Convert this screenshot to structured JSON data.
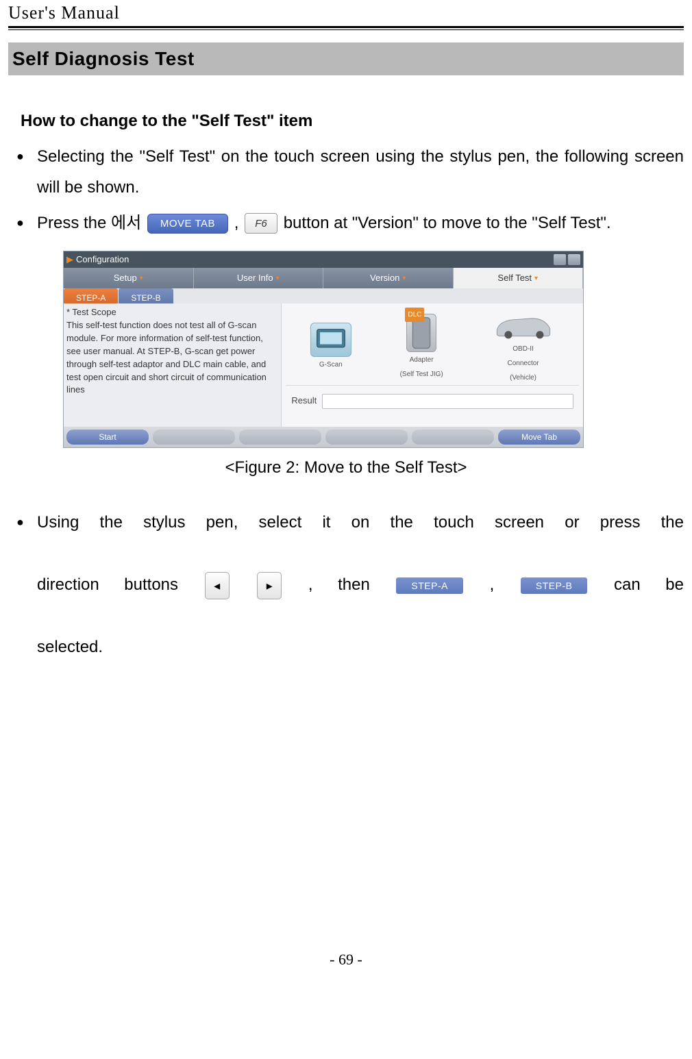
{
  "header": {
    "title": "User's Manual"
  },
  "section_banner": "Self Diagnosis Test",
  "subheading": "How to change to the \"Self Test\" item",
  "bullet1": {
    "text": "Selecting the \"Self Test\" on the touch screen using the stylus pen, the following screen will be shown."
  },
  "bullet2": {
    "pre": "Press the 에서 ",
    "chip_movetab": "MOVE TAB",
    "mid1": ", ",
    "chip_key": "F6",
    "post": " button at \"Version\" to move to the \"Self Test\"."
  },
  "figure": {
    "window": {
      "titlebar_arrow": "▶",
      "title": "Configuration",
      "tabs": {
        "setup": "Setup",
        "userinfo": "User Info",
        "version": "Version",
        "selftest": "Self Test"
      },
      "subtabs": {
        "a": "STEP-A",
        "b": "STEP-B"
      },
      "scope_title": "* Test Scope",
      "scope_body": "This self-test function does not test all of G-scan module. For more information of self-test function, see user manual. At STEP-B, G-scan get power through self-test adaptor and DLC main cable, and test open circuit and short circuit of communication lines",
      "dlc_label": "DLC",
      "dev_gscan": "G-Scan",
      "dev_adapter_l1": "Adapter",
      "dev_adapter_l2": "(Self Test JIG)",
      "dev_conn_l1": "OBD-II",
      "dev_conn_l2": "Connector",
      "dev_conn_l3": "(Vehicle)",
      "result_label": "Result",
      "footer": {
        "start": "Start",
        "movetab": "Move Tab"
      }
    },
    "caption": "<Figure 2: Move to the Self Test>"
  },
  "bullet3": {
    "line1_pre": "Using the stylus pen, select it on the touch screen or press the",
    "line2_a": "direction buttons ",
    "arrow_left": "◂",
    "arrow_right": "▸",
    "line2_b": ", then ",
    "step_a": "STEP-A",
    "line2_c": ", ",
    "step_b": "STEP-B",
    "line2_d": " can be",
    "line3": "selected."
  },
  "page_number": "- 69 -"
}
